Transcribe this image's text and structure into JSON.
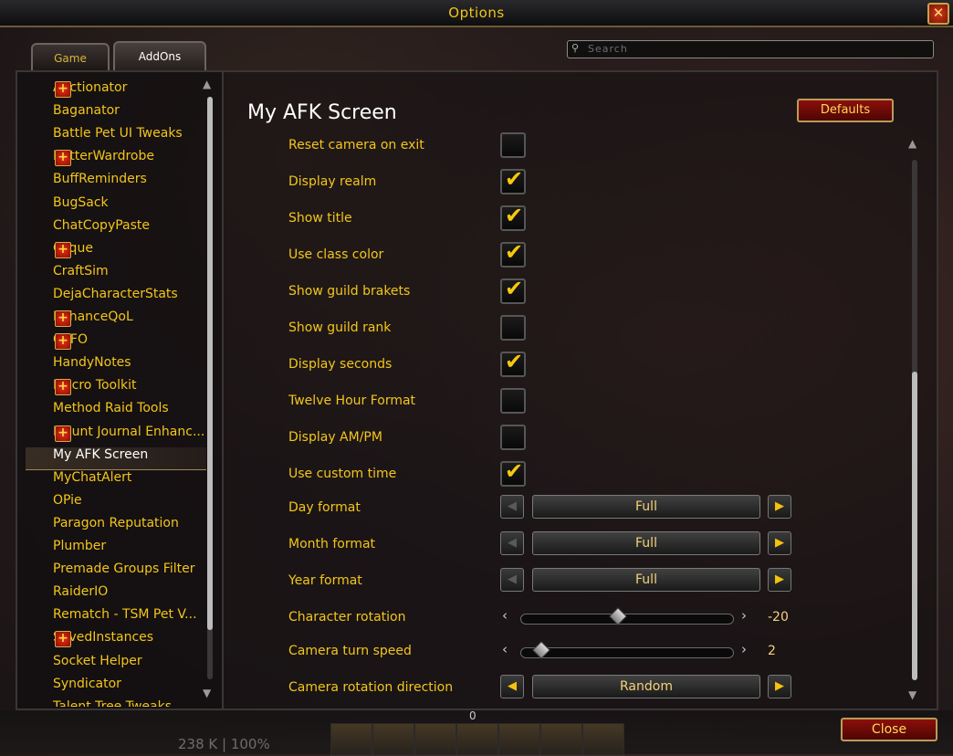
{
  "window": {
    "title": "Options",
    "close_symbol": "✕"
  },
  "tabs": [
    {
      "label": "Game",
      "active": false
    },
    {
      "label": "AddOns",
      "active": true
    }
  ],
  "search": {
    "placeholder": "Search"
  },
  "addons": [
    {
      "name": "Auctionator",
      "expandable": true
    },
    {
      "name": "Baganator",
      "expandable": false
    },
    {
      "name": "Battle Pet UI Tweaks",
      "expandable": false
    },
    {
      "name": "BetterWardrobe",
      "expandable": true
    },
    {
      "name": "BuffReminders",
      "expandable": false
    },
    {
      "name": "BugSack",
      "expandable": false
    },
    {
      "name": "ChatCopyPaste",
      "expandable": false
    },
    {
      "name": "Clique",
      "expandable": true
    },
    {
      "name": "CraftSim",
      "expandable": false
    },
    {
      "name": "DejaCharacterStats",
      "expandable": false
    },
    {
      "name": "EnhanceQoL",
      "expandable": true
    },
    {
      "name": "GTFO",
      "expandable": true
    },
    {
      "name": "HandyNotes",
      "expandable": false
    },
    {
      "name": "Macro Toolkit",
      "expandable": true
    },
    {
      "name": "Method Raid Tools",
      "expandable": false
    },
    {
      "name": "Mount Journal Enhanc...",
      "expandable": true
    },
    {
      "name": "My AFK Screen",
      "expandable": false,
      "selected": true
    },
    {
      "name": "MyChatAlert",
      "expandable": false
    },
    {
      "name": "OPie",
      "expandable": false
    },
    {
      "name": "Paragon Reputation",
      "expandable": false
    },
    {
      "name": "Plumber",
      "expandable": false
    },
    {
      "name": "Premade Groups Filter",
      "expandable": false
    },
    {
      "name": "RaiderIO",
      "expandable": false
    },
    {
      "name": "Rematch - TSM Pet V...",
      "expandable": false
    },
    {
      "name": "SavedInstances",
      "expandable": true
    },
    {
      "name": "Socket Helper",
      "expandable": false
    },
    {
      "name": "Syndicator",
      "expandable": false
    },
    {
      "name": "Talent Tree Tweaks",
      "expandable": false
    }
  ],
  "plus_symbol": "+",
  "panel": {
    "title": "My AFK Screen",
    "defaults_label": "Defaults"
  },
  "settings": [
    {
      "label": "Reset camera on exit",
      "type": "checkbox",
      "checked": false
    },
    {
      "label": "Display realm",
      "type": "checkbox",
      "checked": true
    },
    {
      "label": "Show title",
      "type": "checkbox",
      "checked": true
    },
    {
      "label": "Use class color",
      "type": "checkbox",
      "checked": true
    },
    {
      "label": "Show guild brakets",
      "type": "checkbox",
      "checked": true
    },
    {
      "label": "Show guild rank",
      "type": "checkbox",
      "checked": false
    },
    {
      "label": "Display seconds",
      "type": "checkbox",
      "checked": true
    },
    {
      "label": "Twelve Hour Format",
      "type": "checkbox",
      "checked": false
    },
    {
      "label": "Display AM/PM",
      "type": "checkbox",
      "checked": false
    },
    {
      "label": "Use custom time",
      "type": "checkbox",
      "checked": true
    },
    {
      "label": "Day format",
      "type": "dropdown",
      "value": "Full",
      "left_enabled": false,
      "right_enabled": true
    },
    {
      "label": "Month format",
      "type": "dropdown",
      "value": "Full",
      "left_enabled": false,
      "right_enabled": true
    },
    {
      "label": "Year format",
      "type": "dropdown",
      "value": "Full",
      "left_enabled": false,
      "right_enabled": true
    },
    {
      "label": "Character rotation",
      "type": "slider",
      "value": "-20",
      "fraction": 0.45
    },
    {
      "label": "Camera turn speed",
      "type": "slider",
      "value": "2",
      "fraction": 0.07
    },
    {
      "label": "Camera rotation direction",
      "type": "dropdown",
      "value": "Random",
      "left_enabled": true,
      "right_enabled": true
    }
  ],
  "checkmark_symbol": "✔",
  "arrow_left": "◀",
  "arrow_right": "▶",
  "slider_left": "‹",
  "slider_right": "›",
  "footer": {
    "close_label": "Close",
    "status_text": "238 K | 100%",
    "zero_text": "0"
  }
}
